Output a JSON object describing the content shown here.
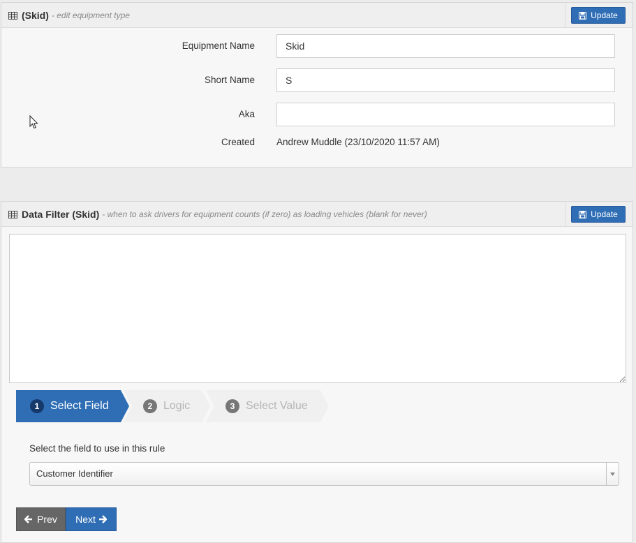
{
  "equipment_panel": {
    "title": "(Skid)",
    "subtitle": "- edit equipment type",
    "update_label": "Update",
    "fields": {
      "equipment_name": {
        "label": "Equipment Name",
        "value": "Skid"
      },
      "short_name": {
        "label": "Short Name",
        "value": "S"
      },
      "aka": {
        "label": "Aka",
        "value": ""
      },
      "created": {
        "label": "Created",
        "value": "Andrew Muddle (23/10/2020 11:57 AM)"
      }
    }
  },
  "filter_panel": {
    "title": "Data Filter (Skid)",
    "subtitle": "- when to ask drivers for equipment counts (if zero) as loading vehicles (blank for never)",
    "update_label": "Update",
    "filter_text": "",
    "steps": [
      {
        "number": "1",
        "label": "Select Field",
        "active": true
      },
      {
        "number": "2",
        "label": "Logic",
        "active": false
      },
      {
        "number": "3",
        "label": "Select Value",
        "active": false
      }
    ],
    "rule_label": "Select the field to use in this rule",
    "selected_field": "Customer Identifier",
    "prev_label": "Prev",
    "next_label": "Next"
  },
  "colors": {
    "primary": "#2f6eb5",
    "active_step_number": "#15396b",
    "prev_button": "#666666",
    "panel_background": "#f7f7f7"
  },
  "icons": {
    "table": "table-icon",
    "save": "save-icon",
    "arrow_left": "arrow-left-icon",
    "arrow_right": "arrow-right-icon",
    "caret_down": "caret-down-icon",
    "cursor": "mouse-cursor-icon"
  }
}
